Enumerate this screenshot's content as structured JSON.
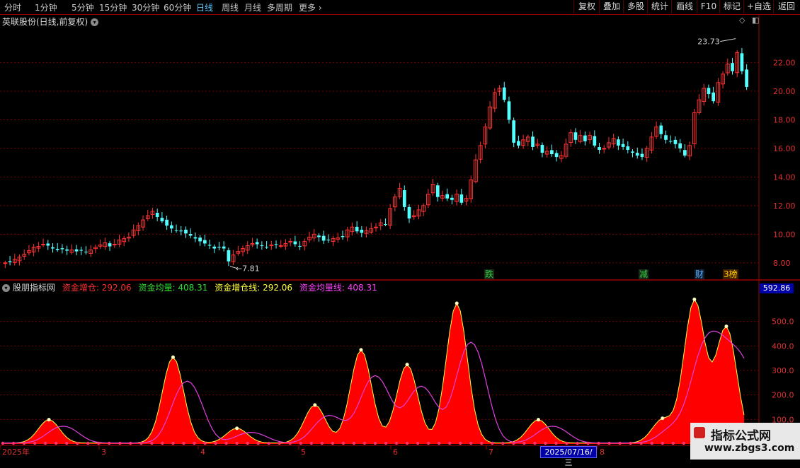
{
  "toolbar": {
    "tabs": [
      "分时",
      "1分钟",
      "5分钟",
      "15分钟",
      "30分钟",
      "60分钟",
      "日线",
      "周线",
      "月线",
      "多周期",
      "更多"
    ],
    "active_tab": "日线",
    "more_arrow": "›",
    "right_buttons": [
      "复权",
      "叠加",
      "多股",
      "统计",
      "画线",
      "F10",
      "标记",
      "+自选",
      "返回"
    ]
  },
  "chart_title": "英联股份(日线,前复权)",
  "title_icon": "chevron-down-icon",
  "price_axis": {
    "ticks": [
      "22.00",
      "20.00",
      "18.00",
      "16.00",
      "14.00",
      "12.00",
      "10.00",
      "8.00"
    ]
  },
  "annotations": {
    "high": "23.73",
    "low": "7.81"
  },
  "events": [
    {
      "label": "跌",
      "color": "#2ecc40",
      "bg": "#1a2a1a"
    },
    {
      "label": "减",
      "color": "#2ecc40",
      "bg": "#1a2a1a"
    },
    {
      "label": "财",
      "color": "#5ab0ff",
      "bg": "#102030"
    },
    {
      "label": "龙虎榜",
      "display": "3榜",
      "color": "#ffcc00",
      "bg": "#402000"
    }
  ],
  "indicator": {
    "name": "股朋指标网",
    "items": [
      {
        "label": "资金增仓: 292.06",
        "color": "#ff3030"
      },
      {
        "label": "资金均量: 408.31",
        "color": "#30e030"
      },
      {
        "label": "资金增仓线: 292.06",
        "color": "#ffff40"
      },
      {
        "label": "资金均量线: 408.31",
        "color": "#ff40ff"
      }
    ],
    "axis_ticks": [
      "500.0",
      "400.0",
      "300.0",
      "200.0",
      "100.0"
    ],
    "current_value": "592.86"
  },
  "x_axis": {
    "labels": [
      "2025年",
      "3",
      "4",
      "5",
      "6",
      "7",
      "8"
    ]
  },
  "crosshair_date": "2025/07/16/三",
  "watermark": {
    "line1": "指标公式网",
    "line2": "www.zbgs3.com"
  },
  "colors": {
    "up": "#ff3232",
    "down": "#54ffff",
    "grid": "#7a0000",
    "axis": "#e03030",
    "fill": "#ff0000",
    "ma": "#e040e0"
  },
  "chart_data": {
    "type": "candlestick",
    "ylim": [
      7.0,
      24.5
    ],
    "close": [
      8.0,
      8.05,
      8.25,
      8.4,
      8.6,
      8.85,
      9.1,
      9.15,
      9.3,
      9.2,
      9.0,
      8.9,
      8.95,
      8.85,
      8.9,
      8.8,
      8.85,
      8.75,
      8.9,
      9.1,
      9.25,
      9.4,
      9.15,
      9.3,
      9.6,
      9.7,
      9.8,
      10.3,
      10.6,
      11.0,
      11.3,
      11.6,
      11.2,
      10.9,
      10.6,
      10.4,
      10.25,
      10.2,
      10.05,
      9.9,
      9.7,
      9.5,
      9.35,
      9.2,
      9.0,
      9.1,
      9.0,
      8.1,
      8.55,
      8.8,
      9.0,
      9.2,
      9.35,
      9.3,
      9.2,
      9.1,
      9.25,
      9.3,
      9.2,
      9.35,
      9.5,
      9.3,
      9.15,
      9.5,
      9.8,
      10.0,
      9.8,
      9.55,
      9.6,
      9.7,
      9.75,
      9.8,
      10.3,
      10.5,
      10.2,
      10.1,
      10.25,
      10.4,
      10.5,
      10.8,
      10.7,
      11.8,
      12.6,
      13.2,
      11.9,
      11.1,
      11.3,
      11.7,
      12.0,
      12.8,
      13.5,
      12.6,
      12.7,
      12.5,
      12.4,
      12.8,
      12.2,
      12.5,
      13.8,
      15.2,
      16.2,
      17.5,
      18.9,
      19.9,
      20.2,
      19.4,
      18.0,
      16.4,
      16.2,
      16.6,
      16.8,
      16.1,
      16.3,
      15.7,
      15.8,
      15.6,
      15.4,
      15.5,
      16.3,
      17.1,
      16.6,
      16.9,
      16.5,
      16.9,
      16.2,
      15.9,
      16.0,
      16.4,
      16.7,
      16.2,
      16.1,
      15.9,
      15.7,
      15.5,
      15.4,
      16.0,
      16.8,
      17.5,
      17.0,
      16.6,
      16.5,
      16.3,
      16.0,
      15.5,
      16.2,
      18.5,
      19.4,
      20.2,
      19.8,
      19.3,
      20.6,
      21.2,
      21.9,
      21.4,
      22.7,
      21.4,
      20.3
    ]
  }
}
